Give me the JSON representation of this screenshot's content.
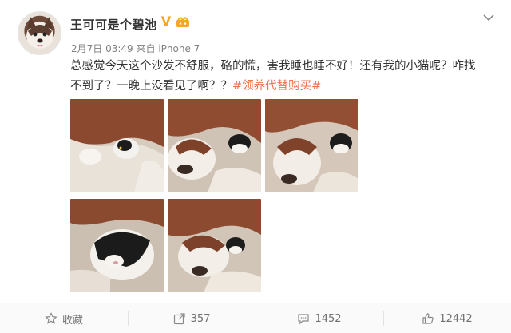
{
  "post": {
    "username": "王可可是个碧池",
    "verified_icon": "v-badge-icon",
    "verified_symbol": "V",
    "member_icon": "vip-crown-icon",
    "date": "2月7日 03:49",
    "source_prefix": "来自",
    "source": "iPhone 7",
    "text_line1": "总感觉今天这个沙发不舒服，硌的慌，害我睡也睡不好！还有我的小猫呢？咋找",
    "text_line2": "不到了？一晚上没看见了啊？？",
    "hashtag": "#领养代替购买#"
  },
  "photos": [
    {
      "name": "dog-cat-photo-1",
      "alt": "husky-and-kitten"
    },
    {
      "name": "dog-cat-photo-2",
      "alt": "husky-and-kitten"
    },
    {
      "name": "dog-cat-photo-3",
      "alt": "husky-and-kitten"
    },
    {
      "name": "dog-cat-photo-4",
      "alt": "kitten-closeup"
    },
    {
      "name": "dog-cat-photo-5",
      "alt": "husky-and-kitten"
    }
  ],
  "actions": {
    "favorite_label": "收藏",
    "forward_count": "357",
    "comment_count": "1452",
    "like_count": "12442"
  },
  "colors": {
    "accent": "#eb7350",
    "text": "#333333",
    "meta": "#808080",
    "badge": "#f5a623"
  }
}
